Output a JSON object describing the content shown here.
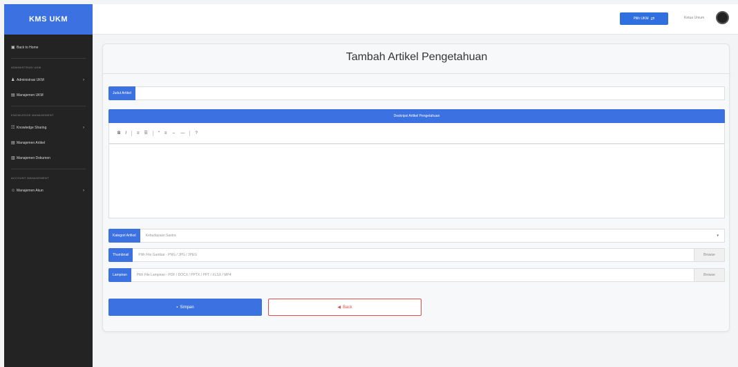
{
  "sidebar": {
    "brand": "KMS UKM",
    "items": [
      {
        "type": "item",
        "label": "Back to Home",
        "icon": "home-icon",
        "chevron": false
      },
      {
        "type": "heading",
        "label": "ADMINISTRASI UKM"
      },
      {
        "type": "item",
        "label": "Administrasi UKM",
        "icon": "users-icon",
        "chevron": true
      },
      {
        "type": "item",
        "label": "Manajemen UKM",
        "icon": "list-icon",
        "chevron": false
      },
      {
        "type": "heading",
        "label": "KNOWLEDGE MANAGEMENT"
      },
      {
        "type": "item",
        "label": "Knowledge Sharing",
        "icon": "share-icon",
        "chevron": true
      },
      {
        "type": "item",
        "label": "Manajemen Artikel",
        "icon": "article-icon",
        "chevron": false
      },
      {
        "type": "item",
        "label": "Manajemen Dokumen",
        "icon": "document-icon",
        "chevron": false
      },
      {
        "type": "heading",
        "label": "ACCOUNT MANAGEMENT"
      },
      {
        "type": "item",
        "label": "Manajemen Akun",
        "icon": "account-icon",
        "chevron": true
      }
    ]
  },
  "topbar": {
    "ukm_button": "Pilih UKM",
    "user_name": "Ketua Umum"
  },
  "form": {
    "title": "Tambah Artikel Pengetahuan",
    "judul_label": "Judul Artikel",
    "judul_value": "",
    "editor_header": "Deskripsi Artikel Pengetahuan",
    "toolbar": [
      "B",
      "I",
      "≡",
      "☰",
      "“",
      "≡",
      "⇔",
      "—",
      "?"
    ],
    "kategori_label": "Kategori Artikel",
    "kategori_value": "Kebudayaan Sastra",
    "thumbnail_label": "Thumbnail",
    "thumbnail_placeholder": "Pilih File Gambar - PNG / JPG / JPEG",
    "lampiran_label": "Lampiran",
    "lampiran_placeholder": "Pilih File Lampiran - PDF / DOCX / PPTX / PPT / XLSX / MP4",
    "browse_label": "Browse",
    "save_label": "Simpan",
    "back_label": "Back"
  },
  "colors": {
    "primary": "#3b71e0",
    "sidebar": "#232323",
    "danger": "#e04c4c"
  }
}
